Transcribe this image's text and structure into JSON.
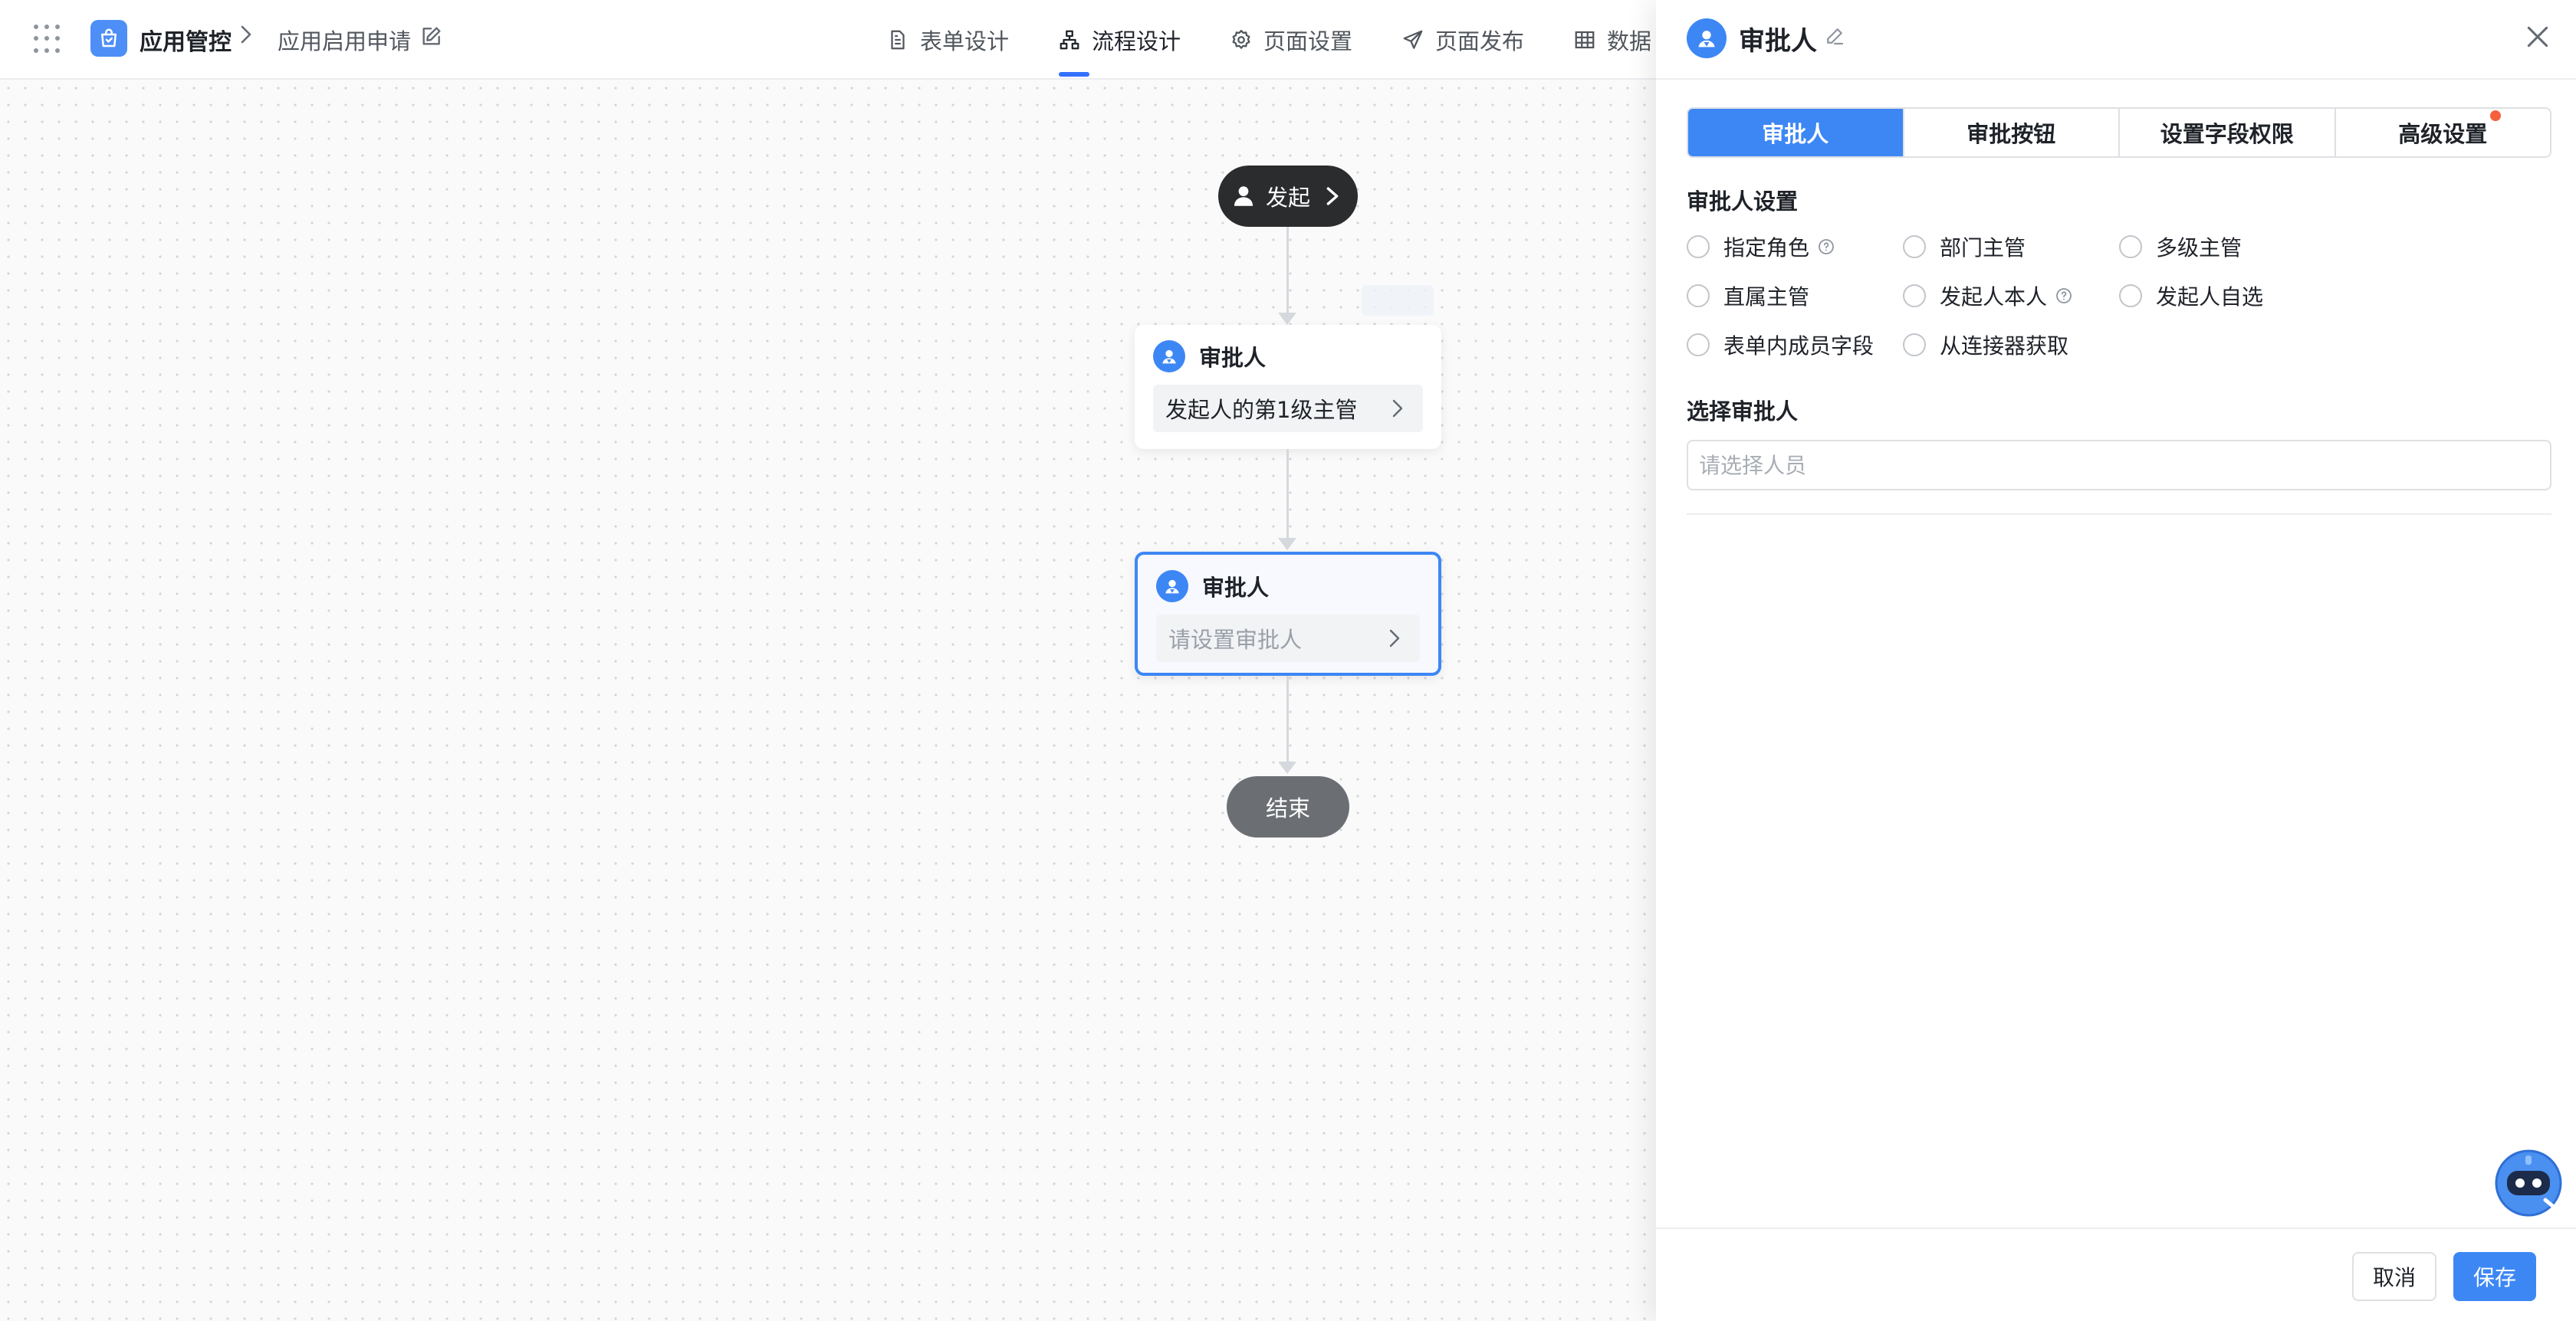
{
  "header": {
    "app_name": "应用管控",
    "breadcrumb_page": "应用启用申请",
    "tabs": [
      {
        "label": "表单设计",
        "icon": "document-icon"
      },
      {
        "label": "流程设计",
        "icon": "flow-icon",
        "active": true
      },
      {
        "label": "页面设置",
        "icon": "gear-icon"
      },
      {
        "label": "页面发布",
        "icon": "send-icon"
      },
      {
        "label": "数据",
        "icon": "table-icon"
      }
    ]
  },
  "flow": {
    "start_label": "发起",
    "nodes": [
      {
        "title": "审批人",
        "value": "发起人的第1级主管"
      },
      {
        "title": "审批人",
        "placeholder": "请设置审批人"
      }
    ],
    "end_label": "结束"
  },
  "panel": {
    "title": "审批人",
    "tabs": [
      "审批人",
      "审批按钮",
      "设置字段权限",
      "高级设置"
    ],
    "active_tab": "审批人",
    "approver_settings_label": "审批人设置",
    "options": [
      "指定角色",
      "部门主管",
      "多级主管",
      "直属主管",
      "发起人本人",
      "发起人自选",
      "表单内成员字段",
      "从连接器获取"
    ],
    "select_label": "选择审批人",
    "select_placeholder": "请选择人员",
    "cancel_label": "取消",
    "save_label": "保存"
  },
  "colors": {
    "primary": "#3d87f5",
    "start_node": "#2b2c2e",
    "end_node": "#6b6e73",
    "notice_dot": "#f5613d"
  }
}
